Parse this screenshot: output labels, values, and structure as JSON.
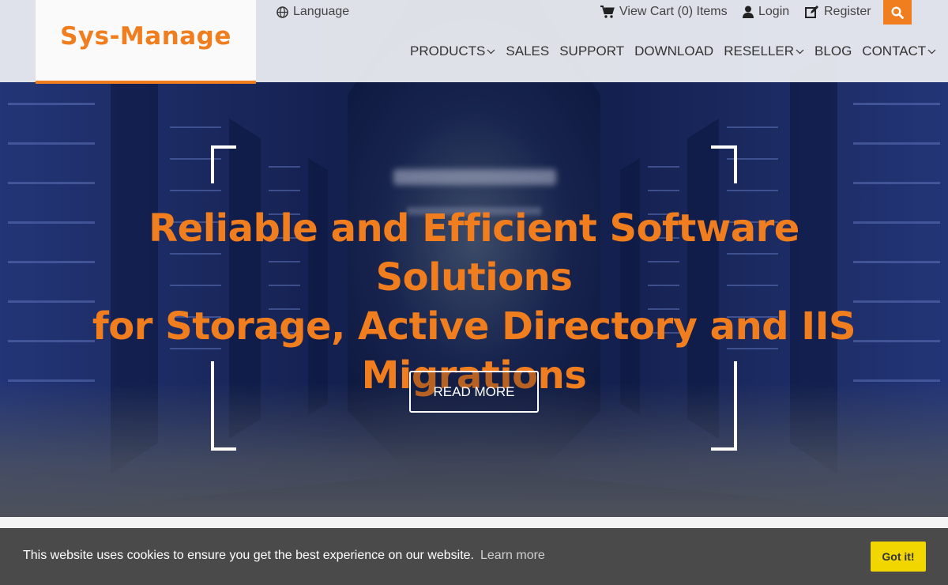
{
  "brand": {
    "logo_text": "Sys-Manage",
    "accent_color": "#f07d1e"
  },
  "topbar": {
    "language": {
      "label": "Language",
      "icon": "globe-icon"
    },
    "cart": {
      "label": "View Cart (0) Items",
      "icon": "cart-icon"
    },
    "login": {
      "label": "Login",
      "icon": "user-icon"
    },
    "register": {
      "label": "Register",
      "icon": "edit-icon"
    },
    "search": {
      "icon": "search-icon"
    }
  },
  "nav": {
    "items": [
      {
        "label": "PRODUCTS",
        "has_dropdown": true
      },
      {
        "label": "SALES",
        "has_dropdown": false
      },
      {
        "label": "SUPPORT",
        "has_dropdown": false
      },
      {
        "label": "DOWNLOAD",
        "has_dropdown": false
      },
      {
        "label": "RESELLER",
        "has_dropdown": true
      },
      {
        "label": "BLOG",
        "has_dropdown": false
      },
      {
        "label": "CONTACT",
        "has_dropdown": true
      }
    ]
  },
  "hero": {
    "headline_line1": "Reliable and Efficient Software Solutions",
    "headline_line2": "for Storage, Active Directory and IIS",
    "headline_line3": "Migrations",
    "cta_label": "READ MORE"
  },
  "cookie_bar": {
    "message": "This website uses cookies to ensure you get the best experience on our website.",
    "learn_more": "Learn more",
    "accept_label": "Got it!",
    "accept_color": "#f1d600"
  }
}
